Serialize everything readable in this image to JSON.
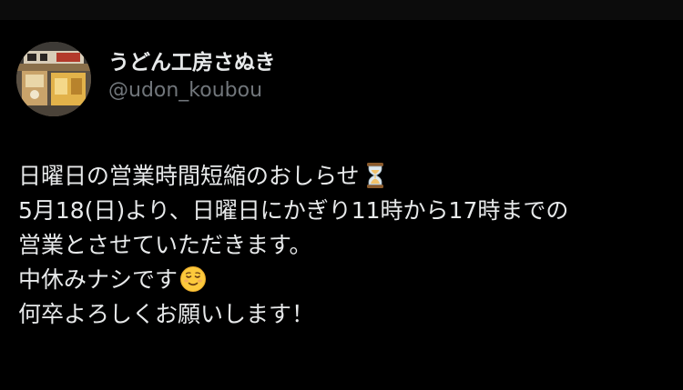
{
  "post": {
    "author": {
      "display_name": "うどん工房さぬき",
      "handle": "@udon_koubou",
      "avatar_icon": "shop-storefront-avatar"
    },
    "body": {
      "line1": "日曜日の営業時間短縮のおしらせ",
      "line1_emoji": "hourglass-icon",
      "line2": "5月18(日)より、日曜日にかぎり11時から17時までの",
      "line3": "営業とさせていただきます。",
      "line4": "中休みナシです",
      "line4_emoji": "relieved-face-emoji",
      "line5": "何卒よろしくお願いします！"
    }
  },
  "colors": {
    "background": "#000000",
    "text_primary": "#e7e9ea",
    "text_secondary": "#71767b"
  }
}
